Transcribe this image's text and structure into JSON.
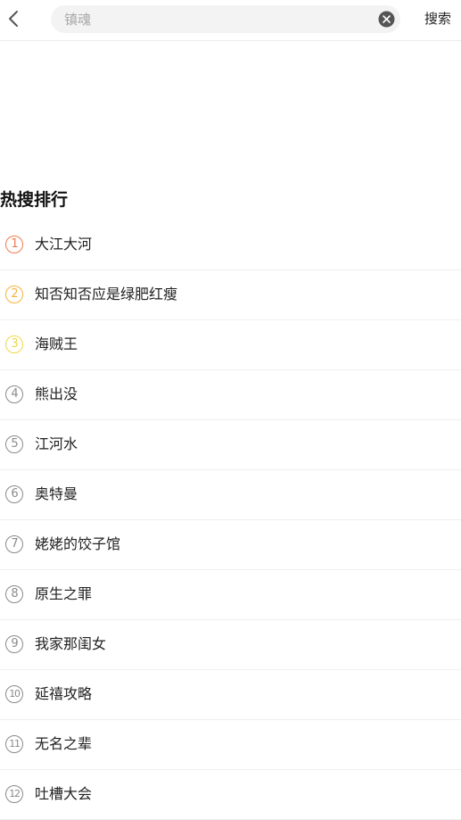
{
  "header": {
    "search_placeholder": "镇魂",
    "search_value": "",
    "submit_label": "搜索"
  },
  "hot": {
    "title": "热搜排行",
    "items": [
      {
        "rank": "1",
        "label": "大江大河",
        "color": "#f07a50"
      },
      {
        "rank": "2",
        "label": "知否知否应是绿肥红瘦",
        "color": "#f5b23c"
      },
      {
        "rank": "3",
        "label": "海贼王",
        "color": "#f0d64a"
      },
      {
        "rank": "4",
        "label": "熊出没",
        "color": "#8a8a8a"
      },
      {
        "rank": "5",
        "label": "江河水",
        "color": "#8a8a8a"
      },
      {
        "rank": "6",
        "label": "奥特曼",
        "color": "#8a8a8a"
      },
      {
        "rank": "7",
        "label": "姥姥的饺子馆",
        "color": "#8a8a8a"
      },
      {
        "rank": "8",
        "label": "原生之罪",
        "color": "#8a8a8a"
      },
      {
        "rank": "9",
        "label": "我家那闺女",
        "color": "#8a8a8a"
      },
      {
        "rank": "10",
        "label": "延禧攻略",
        "color": "#8a8a8a"
      },
      {
        "rank": "11",
        "label": "无名之辈",
        "color": "#8a8a8a"
      },
      {
        "rank": "12",
        "label": "吐槽大会",
        "color": "#8a8a8a"
      }
    ]
  },
  "icons": {
    "back": "chevron-left-icon",
    "clear": "clear-circle-icon"
  }
}
